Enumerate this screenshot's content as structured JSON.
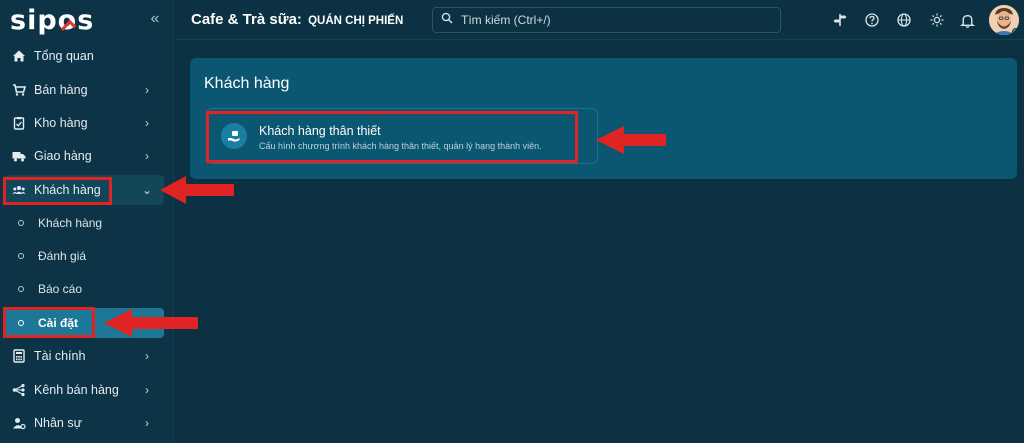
{
  "brand": {
    "logo_text_a": "sip",
    "logo_text_o": "o",
    "logo_text_b": "s"
  },
  "header": {
    "store_title": "Cafe & Trà sữa:",
    "store_name": "QUÁN CHỊ PHIẾN",
    "search_placeholder": "Tìm kiếm (Ctrl+/)"
  },
  "sidebar": {
    "items": [
      {
        "label": "Tổng quan",
        "icon": "home-icon"
      },
      {
        "label": "Bán hàng",
        "icon": "cart-icon"
      },
      {
        "label": "Kho hàng",
        "icon": "clipboard-icon"
      },
      {
        "label": "Giao hàng",
        "icon": "truck-icon"
      },
      {
        "label": "Khách hàng",
        "icon": "users-icon"
      },
      {
        "label": "Tài chính",
        "icon": "calculator-icon"
      },
      {
        "label": "Kênh bán hàng",
        "icon": "network-icon"
      },
      {
        "label": "Nhân sự",
        "icon": "user-settings-icon"
      }
    ],
    "sub_items": [
      {
        "label": "Khách hàng"
      },
      {
        "label": "Đánh giá"
      },
      {
        "label": "Báo cáo"
      },
      {
        "label": "Cài đặt"
      }
    ]
  },
  "main": {
    "section_title": "Khách hàng",
    "tile_title": "Khách hàng thân thiết",
    "tile_desc": "Cấu hình chương trình khách hàng thân thiết, quản lý hạng thành viên."
  },
  "colors": {
    "accent": "#1d7796",
    "annotation": "#e02323",
    "background": "#0b3142",
    "card": "#0b5670"
  }
}
